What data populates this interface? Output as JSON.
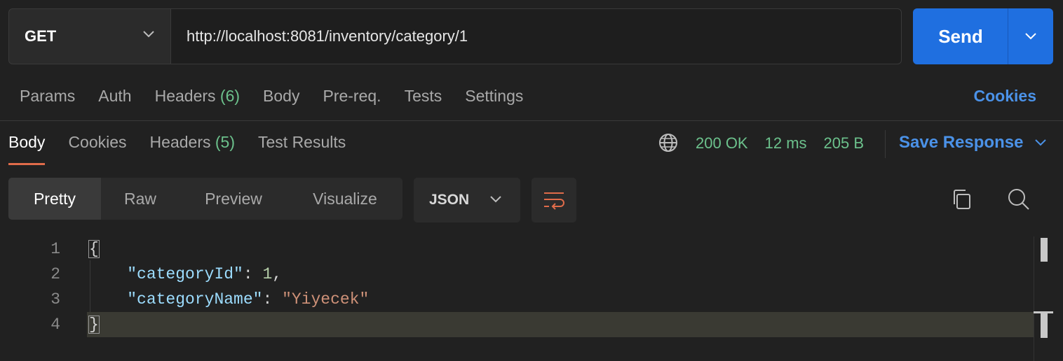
{
  "request": {
    "method": "GET",
    "url": "http://localhost:8081/inventory/category/1",
    "send_label": "Send"
  },
  "request_tabs": {
    "params": "Params",
    "auth": "Auth",
    "headers": "Headers",
    "headers_count": "(6)",
    "body": "Body",
    "prereq": "Pre-req.",
    "tests": "Tests",
    "settings": "Settings",
    "cookies": "Cookies"
  },
  "response_tabs": {
    "body": "Body",
    "cookies": "Cookies",
    "headers": "Headers",
    "headers_count": "(5)",
    "test_results": "Test Results"
  },
  "response_status": {
    "status": "200 OK",
    "time": "12 ms",
    "size": "205 B",
    "save_response": "Save Response"
  },
  "view_modes": {
    "pretty": "Pretty",
    "raw": "Raw",
    "preview": "Preview",
    "visualize": "Visualize",
    "format": "JSON"
  },
  "body_lines": [
    {
      "num": "1",
      "open_brace": "{"
    },
    {
      "num": "2",
      "key": "\"categoryId\"",
      "sep": ": ",
      "value": "1",
      "tail": ","
    },
    {
      "num": "3",
      "key": "\"categoryName\"",
      "sep": ": ",
      "value": "\"Yiyecek\""
    },
    {
      "num": "4",
      "close_brace": "}"
    }
  ],
  "colors": {
    "accent_blue": "#1f6fe0",
    "status_green": "#6cc18c",
    "active_tab_underline": "#e06c4a",
    "json_key": "#9cdcfe",
    "json_number": "#b5cea8",
    "json_string": "#ce9178"
  },
  "icons": [
    "chevron-down-icon",
    "globe-icon",
    "wrap-lines-icon",
    "copy-icon",
    "search-icon"
  ]
}
